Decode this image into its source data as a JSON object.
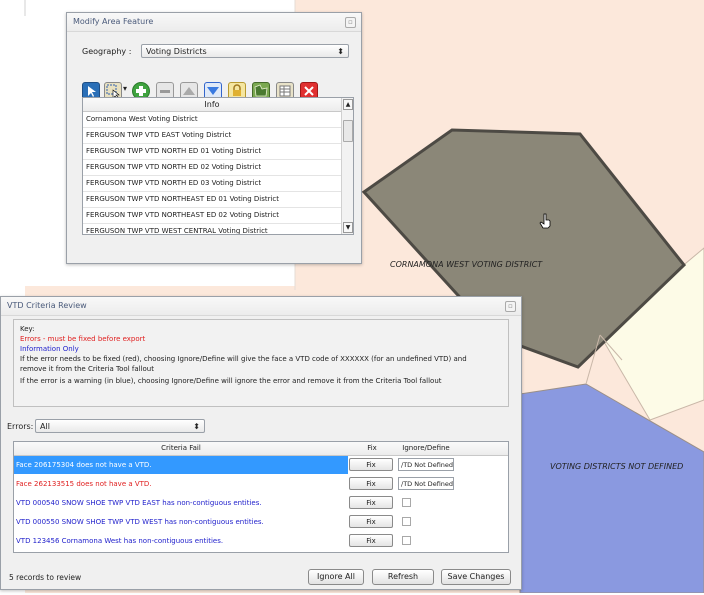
{
  "colors": {
    "map_bg": "#fce8db",
    "selected_polygon": "#8b8778",
    "blue_polygon": "#8a99e0",
    "cream_polygon": "#fdfbe7",
    "error_red": "#e02020",
    "info_blue": "#2222cc",
    "selection_blue": "#3399ff"
  },
  "map": {
    "label_selected": "CORNAMONA WEST VOTING DISTRICT",
    "label_undefined": "VOTING DISTRICTS NOT DEFINED"
  },
  "modify_dialog": {
    "title": "Modify Area Feature",
    "geography_label": "Geography :",
    "geography_value": "Voting Districts",
    "toolbar_icons": [
      "select-cursor-icon",
      "select-tool-icon",
      "add-icon",
      "remove-icon",
      "up-icon",
      "down-icon",
      "lock-icon",
      "map-layer-icon",
      "table-icon",
      "delete-icon"
    ],
    "info_header": "Info",
    "info_rows": [
      "Cornamona West Voting District",
      "FERGUSON TWP VTD EAST Voting District",
      "FERGUSON TWP VTD NORTH ED 01 Voting District",
      "FERGUSON TWP VTD NORTH ED 02 Voting District",
      "FERGUSON TWP VTD NORTH ED 03 Voting District",
      "FERGUSON TWP VTD NORTHEAST ED 01 Voting District",
      "FERGUSON TWP VTD NORTHEAST ED 02 Voting District",
      "FERGUSON TWP VTD WEST CENTRAL Voting District"
    ]
  },
  "criteria_dialog": {
    "title": "VTD Criteria Review",
    "key": {
      "heading": "Key:",
      "errors_line": "Errors - must be fixed before export",
      "info_line": "Information Only",
      "fix_note_1": "If the error needs to be fixed (red), choosing Ignore/Define will give the face a VTD code of XXXXXX (for an undefined VTD) and",
      "fix_note_2": "remove it from the Criteria Tool fallout",
      "warn_note": "If the error is a warning (in blue), choosing Ignore/Define will ignore the error and remove it from the Criteria Tool fallout"
    },
    "errors_label": "Errors:",
    "errors_value": "All",
    "columns": {
      "criteria": "Criteria Fail",
      "fix": "Fix",
      "ignore": "Ignore/Define"
    },
    "fix_label": "Fix",
    "rows": [
      {
        "text": "Face 206175304 does not have a VTD.",
        "kind": "error",
        "ignore": "/TD Not Defined",
        "selected": true
      },
      {
        "text": "Face 262133515 does not have a VTD.",
        "kind": "error",
        "ignore": "/TD Not Defined",
        "selected": false
      },
      {
        "text": "VTD 000540 SNOW SHOE TWP VTD EAST has non-contiguous entities.",
        "kind": "info",
        "ignore": "",
        "selected": false
      },
      {
        "text": "VTD 000550 SNOW SHOE TWP VTD WEST has non-contiguous entities.",
        "kind": "info",
        "ignore": "",
        "selected": false
      },
      {
        "text": "VTD 123456 Cornamona West has non-contiguous entities.",
        "kind": "info",
        "ignore": "",
        "selected": false
      }
    ],
    "records_status": "5 records to review",
    "buttons": {
      "ignore_all": "Ignore All",
      "refresh": "Refresh",
      "save": "Save Changes"
    }
  }
}
